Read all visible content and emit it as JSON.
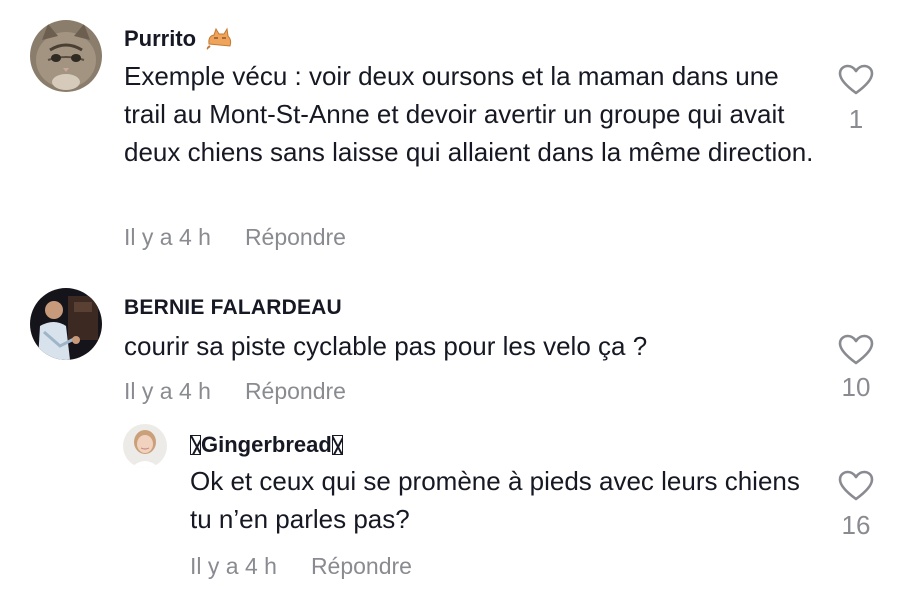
{
  "comments": [
    {
      "username": "Purrito",
      "username_emoji": "cat-icon",
      "text": "Exemple vécu : voir deux oursons et la maman dans une trail au Mont-St-Anne et devoir avertir un groupe qui avait deux chiens sans laisse qui allaient dans la même direction.",
      "time": "Il y a 4 h",
      "reply_label": "Répondre",
      "likes": "1"
    },
    {
      "username": "BERNIE FALARDEAU",
      "text": "courir sa piste cyclable pas pour les velo ça ?",
      "time": "Il y a 4 h",
      "reply_label": "Répondre",
      "likes": "10"
    },
    {
      "username": "Gingerbread",
      "text": "Ok et ceux qui se promène à pieds avec leurs chiens tu n’en parles pas?",
      "time": "Il y a 4 h",
      "reply_label": "Répondre",
      "likes": "16"
    }
  ],
  "icons": {
    "like": "heart-outline-icon"
  },
  "colors": {
    "text": "#161823",
    "muted": "#8a8b91",
    "background": "#ffffff"
  }
}
